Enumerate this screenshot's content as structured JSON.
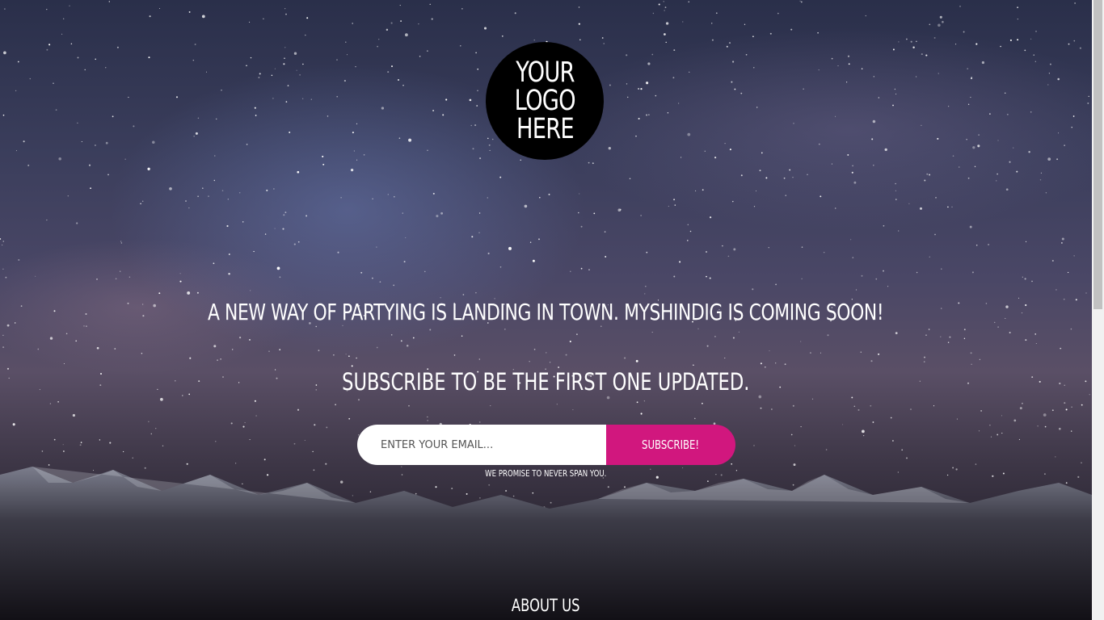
{
  "logo": {
    "lines": [
      "YOUR",
      "LOGO",
      "HERE"
    ]
  },
  "hero": {
    "headline": "A new way of partying is landing in town. MyShindig is coming soon!",
    "subheadline": "Subscribe to be the first one updated."
  },
  "subscribe": {
    "email_placeholder": "Enter your email...",
    "button_label": "Subscribe!",
    "promise": "We promise to never span you."
  },
  "about": {
    "title": "About Us"
  },
  "colors": {
    "accent": "#d1177e",
    "logo_bg": "#000000",
    "text": "#ffffff"
  },
  "icons": [
    "logo-badge"
  ]
}
